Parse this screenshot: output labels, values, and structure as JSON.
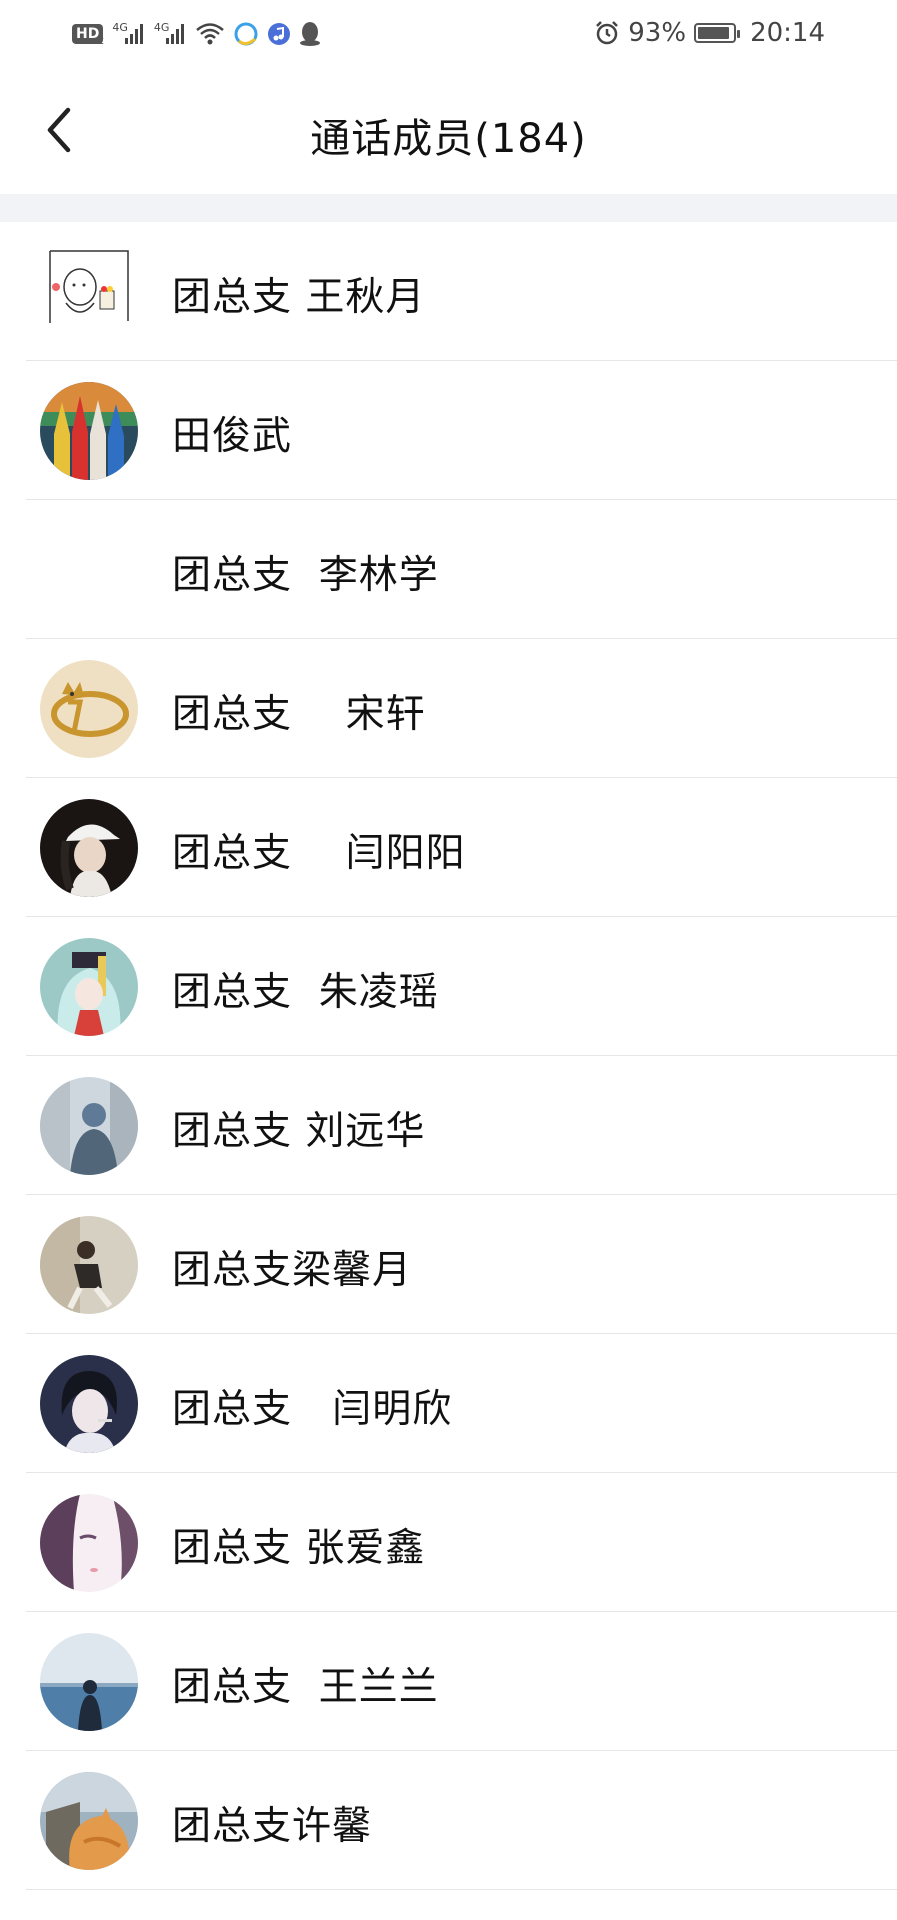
{
  "status_bar": {
    "hd_label": "HD",
    "hd_sub": "2",
    "network_1": "4G",
    "network_2": "4G",
    "battery_percent": "93%",
    "battery_level": 0.93,
    "time": "20:14",
    "icons": [
      "hd-icon",
      "signal-icon",
      "signal-icon",
      "wifi-icon",
      "qq-browser-icon",
      "music-icon",
      "qq-icon",
      "alarm-icon",
      "battery-icon"
    ]
  },
  "header": {
    "back_icon": "chevron-left-icon",
    "title": "通话成员(184)"
  },
  "members": [
    {
      "name": "团总支 王秋月",
      "avatar": "sketch-avatar"
    },
    {
      "name": "田俊武",
      "avatar": "pencils-avatar"
    },
    {
      "name": "团总支  李林学",
      "avatar": "blank-avatar"
    },
    {
      "name": "团总支    宋轩",
      "avatar": "gold-cat-avatar"
    },
    {
      "name": "团总支    闫阳阳",
      "avatar": "girl-cap-avatar"
    },
    {
      "name": "团总支  朱凌瑶",
      "avatar": "anime-girl-avatar"
    },
    {
      "name": "团总支 刘远华",
      "avatar": "street-person-avatar"
    },
    {
      "name": "团总支梁馨月",
      "avatar": "sitting-girl-avatar"
    },
    {
      "name": "团总支   闫明欣",
      "avatar": "anime-boy-avatar"
    },
    {
      "name": "团总支 张爱鑫",
      "avatar": "anime-face-avatar"
    },
    {
      "name": "团总支  王兰兰",
      "avatar": "sea-person-avatar"
    },
    {
      "name": "团总支许馨",
      "avatar": "orange-cat-avatar"
    }
  ],
  "colors": {
    "separator_band": "#f1f3f6",
    "divider": "#e6e6e6",
    "text": "#111111"
  }
}
